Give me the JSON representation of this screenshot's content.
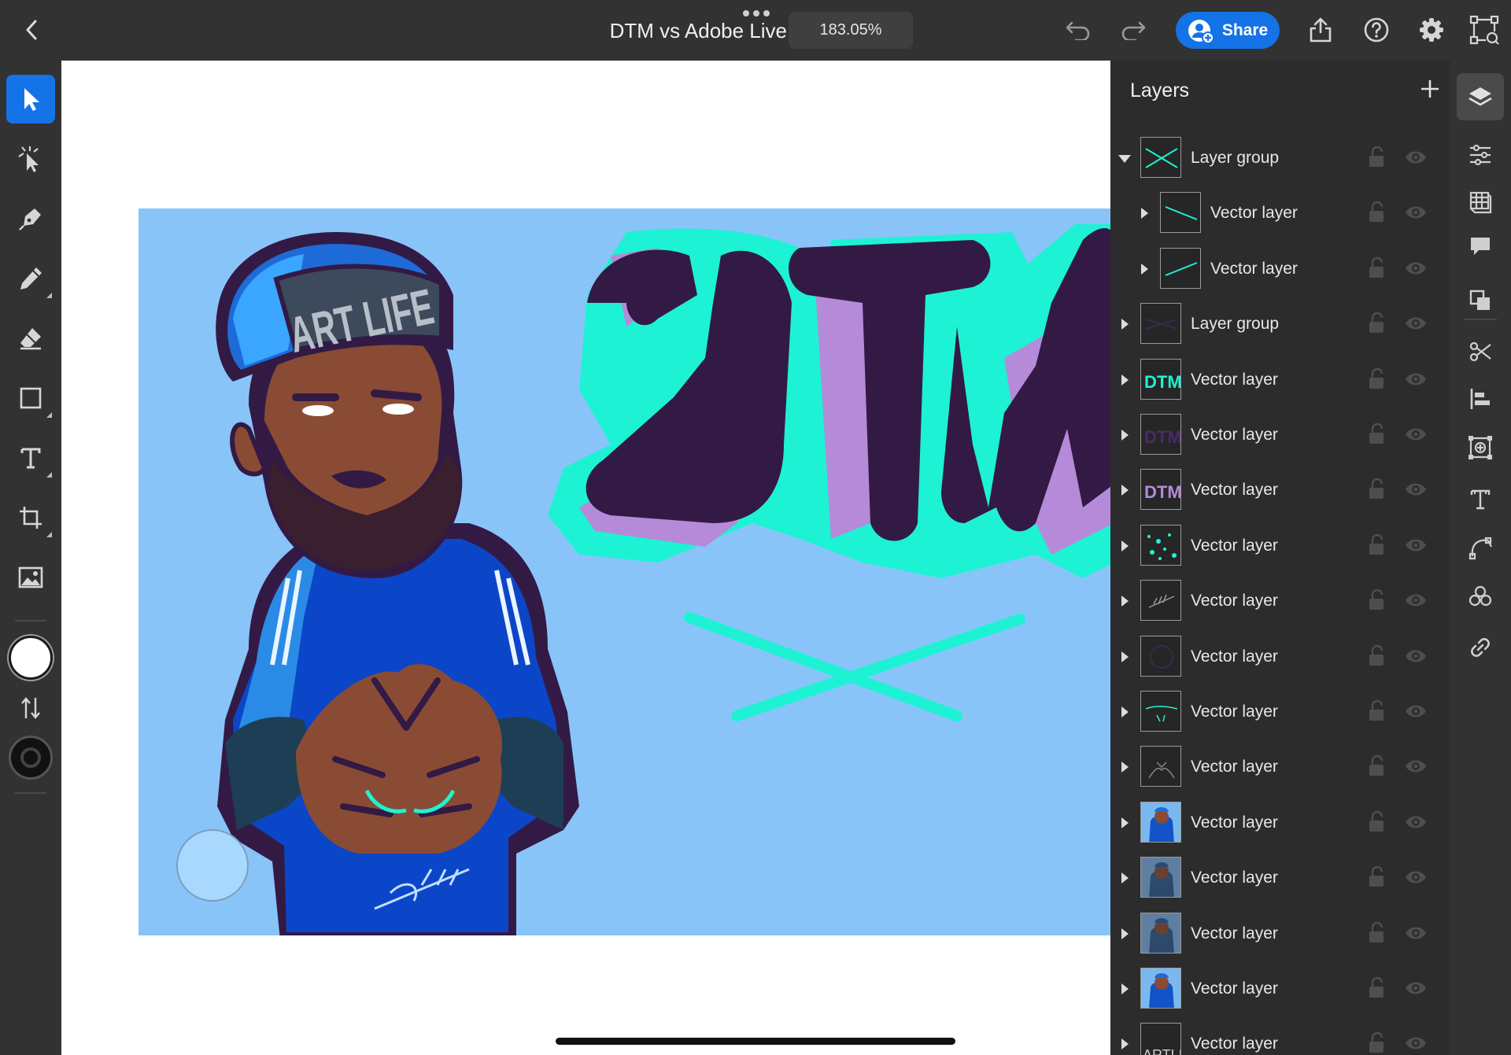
{
  "header": {
    "title": "DTM vs Adobe Live",
    "zoom": "183.05%",
    "share_label": "Share"
  },
  "left_tools": [
    {
      "name": "select-tool",
      "icon": "arrow-pointer-icon",
      "active": true
    },
    {
      "name": "direct-select-tool",
      "icon": "node-select-icon",
      "active": false
    },
    {
      "name": "pen-tool",
      "icon": "pen-nib-icon",
      "active": false
    },
    {
      "name": "pencil-tool",
      "icon": "pencil-icon",
      "active": false
    },
    {
      "name": "eraser-tool",
      "icon": "eraser-icon",
      "active": false
    },
    {
      "name": "rectangle-tool",
      "icon": "rectangle-icon",
      "active": false
    },
    {
      "name": "text-tool",
      "icon": "text-t-icon",
      "active": false
    },
    {
      "name": "transform-tool",
      "icon": "crop-transform-icon",
      "active": false
    },
    {
      "name": "image-tool",
      "icon": "image-icon",
      "active": false
    }
  ],
  "colors": {
    "fill": "#ffffff",
    "stroke": "#111111",
    "accent": "#1473e6",
    "artboard_bg": "#89c4f9",
    "teal": "#1ef2d4",
    "dark_purple": "#331a45",
    "lilac": "#b58ad8"
  },
  "canvas": {
    "cap_text": "ART LIFE"
  },
  "layers": {
    "title": "Layers",
    "items": [
      {
        "name": "Layer group",
        "expanded": true,
        "indent": 0,
        "thumb": "teal-x"
      },
      {
        "name": "Vector layer",
        "expanded": false,
        "indent": 1,
        "thumb": "teal-line-down"
      },
      {
        "name": "Vector layer",
        "expanded": false,
        "indent": 1,
        "thumb": "teal-line-up"
      },
      {
        "name": "Layer group",
        "expanded": false,
        "indent": 0,
        "thumb": "dark-x"
      },
      {
        "name": "Vector layer",
        "expanded": false,
        "indent": 0,
        "thumb": "teal-dtm"
      },
      {
        "name": "Vector layer",
        "expanded": false,
        "indent": 0,
        "thumb": "purple-dtm"
      },
      {
        "name": "Vector layer",
        "expanded": false,
        "indent": 0,
        "thumb": "lilac-dtm"
      },
      {
        "name": "Vector layer",
        "expanded": false,
        "indent": 0,
        "thumb": "teal-dots"
      },
      {
        "name": "Vector layer",
        "expanded": false,
        "indent": 0,
        "thumb": "grey-signature"
      },
      {
        "name": "Vector layer",
        "expanded": false,
        "indent": 0,
        "thumb": "dark-face"
      },
      {
        "name": "Vector layer",
        "expanded": false,
        "indent": 0,
        "thumb": "teal-lines"
      },
      {
        "name": "Vector layer",
        "expanded": false,
        "indent": 0,
        "thumb": "grey-sketch"
      },
      {
        "name": "Vector layer",
        "expanded": false,
        "indent": 0,
        "thumb": "char-blue"
      },
      {
        "name": "Vector layer",
        "expanded": false,
        "indent": 0,
        "thumb": "char-dark"
      },
      {
        "name": "Vector layer",
        "expanded": false,
        "indent": 0,
        "thumb": "char-dark"
      },
      {
        "name": "Vector layer",
        "expanded": false,
        "indent": 0,
        "thumb": "char-blue"
      },
      {
        "name": "Vector layer",
        "expanded": false,
        "indent": 0,
        "thumb": "artlife-text"
      }
    ]
  },
  "right_rail": [
    {
      "name": "layers-panel-button",
      "icon": "layers-stack-icon",
      "active": true
    },
    {
      "name": "properties-button",
      "icon": "sliders-icon",
      "active": false
    },
    {
      "name": "libraries-button",
      "icon": "library-book-icon",
      "active": false
    },
    {
      "name": "comments-button",
      "icon": "comment-bubble-icon",
      "active": false
    },
    {
      "name": "arrange-button",
      "icon": "overlap-squares-icon",
      "active": false
    },
    {
      "name": "scissors-button",
      "icon": "scissors-icon",
      "active": false
    },
    {
      "name": "align-button",
      "icon": "align-left-icon",
      "active": false
    },
    {
      "name": "repeat-grid-button",
      "icon": "repeat-grid-icon",
      "active": false
    },
    {
      "name": "type-button",
      "icon": "type-settings-icon",
      "active": false
    },
    {
      "name": "path-button",
      "icon": "path-curve-icon",
      "active": false
    },
    {
      "name": "shape-builder-button",
      "icon": "shape-builder-icon",
      "active": false
    },
    {
      "name": "link-button",
      "icon": "link-chain-icon",
      "active": false
    }
  ]
}
